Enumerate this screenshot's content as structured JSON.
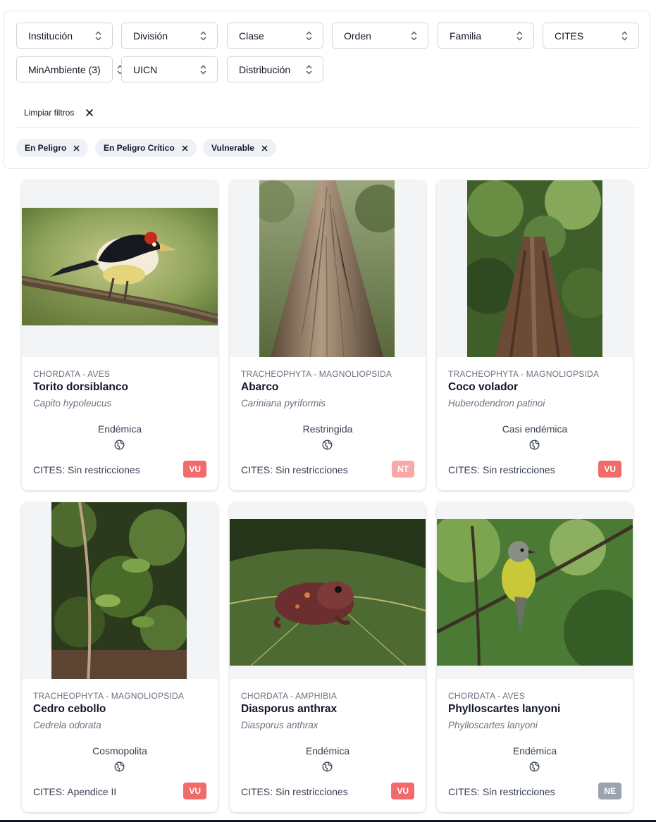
{
  "filters": {
    "selects": [
      {
        "label": "Institución"
      },
      {
        "label": "División"
      },
      {
        "label": "Clase"
      },
      {
        "label": "Orden"
      },
      {
        "label": "Familia"
      },
      {
        "label": "CITES"
      },
      {
        "label": "MinAmbiente (3)"
      },
      {
        "label": "UICN"
      },
      {
        "label": "Distribución"
      }
    ],
    "clear_label": "Limpiar filtros",
    "chips": [
      {
        "label": "En Peligro"
      },
      {
        "label": "En Peligro Crítico"
      },
      {
        "label": "Vulnerable"
      }
    ]
  },
  "species": [
    {
      "taxon": "CHORDATA - AVES",
      "common_name": "Torito dorsiblanco",
      "scientific_name": "Capito hypoleucus",
      "distribution": "Endémica",
      "cites": "CITES: Sin restricciones",
      "status": "VU",
      "status_color": "#f16b6b",
      "photo": "bird-barbet"
    },
    {
      "taxon": "TRACHEOPHYTA - MAGNOLIOPSIDA",
      "common_name": "Abarco",
      "scientific_name": "Cariniana pyriformis",
      "distribution": "Restringida",
      "cites": "CITES: Sin restricciones",
      "status": "NT",
      "status_color": "#f9a8a8",
      "photo": "tree-trunk"
    },
    {
      "taxon": "TRACHEOPHYTA - MAGNOLIOPSIDA",
      "common_name": "Coco volador",
      "scientific_name": "Huberodendron patinoi",
      "distribution": "Casi endémica",
      "cites": "CITES: Sin restricciones",
      "status": "VU",
      "status_color": "#f16b6b",
      "photo": "forest-tree"
    },
    {
      "taxon": "TRACHEOPHYTA - MAGNOLIOPSIDA",
      "common_name": "Cedro cebollo",
      "scientific_name": "Cedrela odorata",
      "distribution": "Cosmopolita",
      "cites": "CITES: Apendice II",
      "status": "VU",
      "status_color": "#f16b6b",
      "photo": "sapling"
    },
    {
      "taxon": "CHORDATA - AMPHIBIA",
      "common_name": "Diasporus anthrax",
      "scientific_name": "Diasporus anthrax",
      "distribution": "Endémica",
      "cites": "CITES: Sin restricciones",
      "status": "VU",
      "status_color": "#f16b6b",
      "photo": "frog"
    },
    {
      "taxon": "CHORDATA - AVES",
      "common_name": "Phylloscartes lanyoni",
      "scientific_name": "Phylloscartes lanyoni",
      "distribution": "Endémica",
      "cites": "CITES: Sin restricciones",
      "status": "NE",
      "status_color": "#9aa3af",
      "photo": "bird-tyrannulet"
    }
  ]
}
